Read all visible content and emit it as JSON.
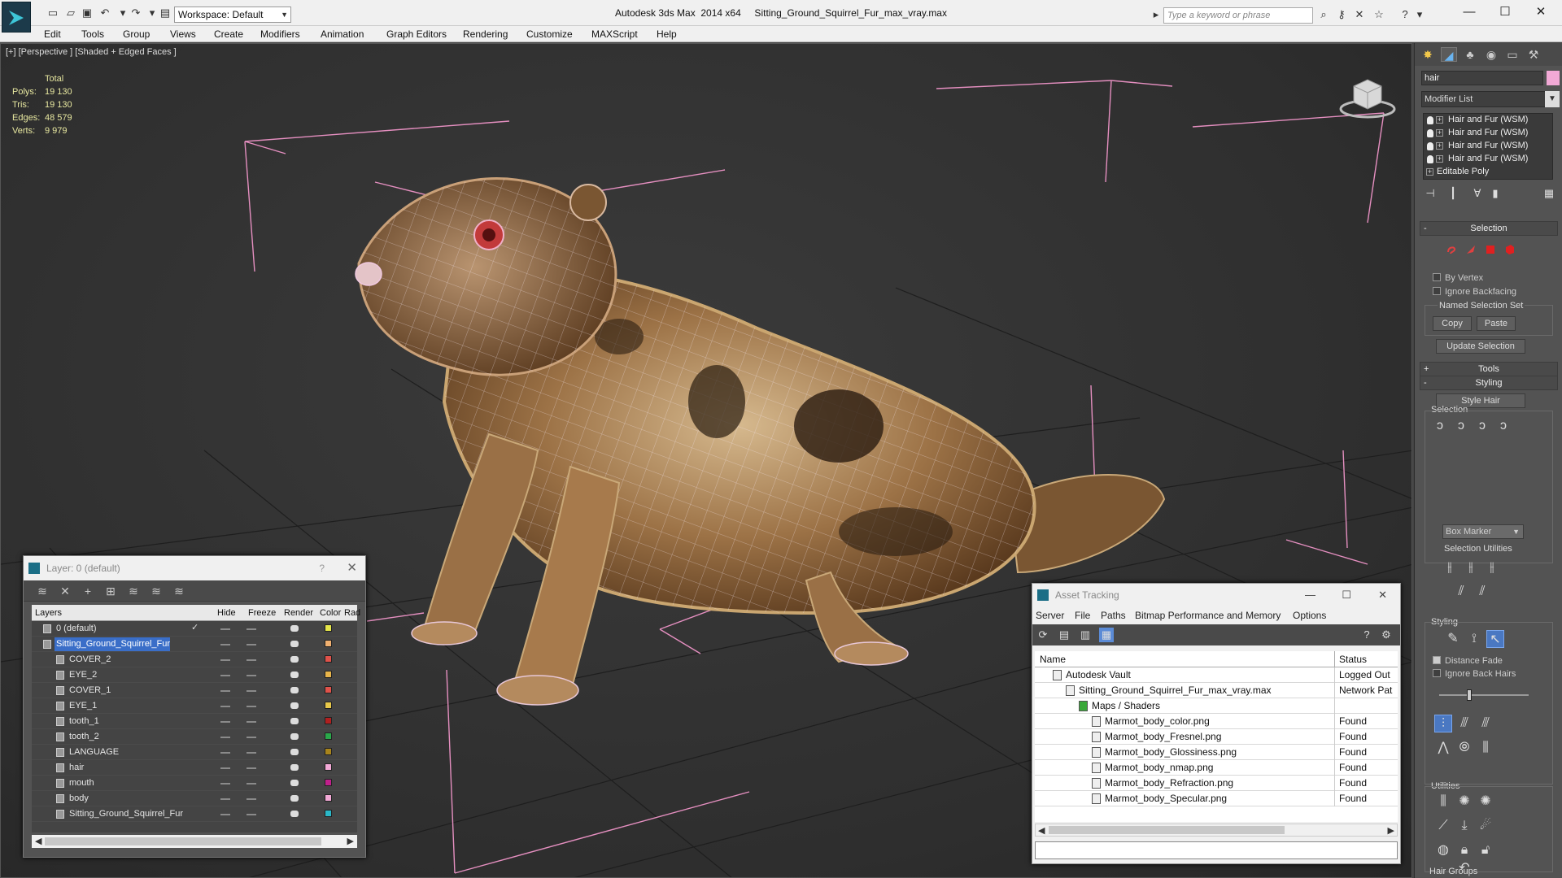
{
  "titlebar": {
    "workspace": "Workspace: Default",
    "title": "Autodesk 3ds Max  2014 x64     Sitting_Ground_Squirrel_Fur_max_vray.max",
    "search_placeholder": "Type a keyword or phrase",
    "icons": [
      "new-icon",
      "open-icon",
      "save-icon",
      "undo-icon",
      "redo-icon",
      "project-icon"
    ],
    "right_icons": [
      "binoculars-icon",
      "key-icon",
      "communication-icon",
      "star-icon",
      "help-icon"
    ]
  },
  "menu": [
    "Edit",
    "Tools",
    "Group",
    "Views",
    "Create",
    "Modifiers",
    "Animation",
    "Graph Editors",
    "Rendering",
    "Customize",
    "MAXScript",
    "Help"
  ],
  "viewport": {
    "label": "[+] [Perspective ] [Shaded + Edged Faces ]",
    "stats_header": "Total",
    "stats": [
      {
        "key": "Polys:",
        "value": "19 130"
      },
      {
        "key": "Tris:",
        "value": "19 130"
      },
      {
        "key": "Edges:",
        "value": "48 579"
      },
      {
        "key": "Verts:",
        "value": "9 979"
      }
    ]
  },
  "layer_window": {
    "title": "Layer: 0 (default)",
    "help": "?",
    "columns": [
      "Layers",
      "Hide",
      "Freeze",
      "Render",
      "Color",
      "Rad"
    ],
    "rows": [
      {
        "name": "0 (default)",
        "indent": 0,
        "color": "#e6e64a",
        "check": "✓",
        "selected": false
      },
      {
        "name": "Sitting_Ground_Squirrel_Fur",
        "indent": 0,
        "color": "#f0b070",
        "check": "",
        "selected": true
      },
      {
        "name": "COVER_2",
        "indent": 1,
        "color": "#e0524a",
        "check": "",
        "selected": false
      },
      {
        "name": "EYE_2",
        "indent": 1,
        "color": "#e8b44a",
        "check": "",
        "selected": false
      },
      {
        "name": "COVER_1",
        "indent": 1,
        "color": "#e0524a",
        "check": "",
        "selected": false
      },
      {
        "name": "EYE_1",
        "indent": 1,
        "color": "#e8c84a",
        "check": "",
        "selected": false
      },
      {
        "name": "tooth_1",
        "indent": 1,
        "color": "#b02020",
        "check": "",
        "selected": false
      },
      {
        "name": "tooth_2",
        "indent": 1,
        "color": "#2aa84a",
        "check": "",
        "selected": false
      },
      {
        "name": "LANGUAGE",
        "indent": 1,
        "color": "#a8841c",
        "check": "",
        "selected": false
      },
      {
        "name": "hair",
        "indent": 1,
        "color": "#f2a9d6",
        "check": "",
        "selected": false
      },
      {
        "name": "mouth",
        "indent": 1,
        "color": "#c0208c",
        "check": "",
        "selected": false
      },
      {
        "name": "body",
        "indent": 1,
        "color": "#f2a9d6",
        "check": "",
        "selected": false
      },
      {
        "name": "Sitting_Ground_Squirrel_Fur",
        "indent": 1,
        "color": "#2ab8c8",
        "check": "",
        "selected": false
      }
    ]
  },
  "asset_window": {
    "title": "Asset Tracking",
    "menu": [
      "Server",
      "File",
      "Paths",
      "Bitmap Performance and Memory",
      "Options"
    ],
    "columns": [
      "Name",
      "Status"
    ],
    "rows": [
      {
        "name": "Autodesk Vault",
        "indent": 0,
        "status": "Logged Out"
      },
      {
        "name": "Sitting_Ground_Squirrel_Fur_max_vray.max",
        "indent": 1,
        "status": "Network Pat"
      },
      {
        "name": "Maps / Shaders",
        "indent": 2,
        "status": ""
      },
      {
        "name": "Marmot_body_color.png",
        "indent": 3,
        "status": "Found"
      },
      {
        "name": "Marmot_body_Fresnel.png",
        "indent": 3,
        "status": "Found"
      },
      {
        "name": "Marmot_body_Glossiness.png",
        "indent": 3,
        "status": "Found"
      },
      {
        "name": "Marmot_body_nmap.png",
        "indent": 3,
        "status": "Found"
      },
      {
        "name": "Marmot_body_Refraction.png",
        "indent": 3,
        "status": "Found"
      },
      {
        "name": "Marmot_body_Specular.png",
        "indent": 3,
        "status": "Found"
      }
    ]
  },
  "command_panel": {
    "object_name": "hair",
    "object_color": "#f2a9d6",
    "modifier_list": "Modifier List",
    "stack": [
      "Hair and Fur (WSM)",
      "Hair and Fur (WSM)",
      "Hair and Fur (WSM)",
      "Hair and Fur (WSM)",
      "Editable Poly"
    ],
    "selection_rollout": "Selection",
    "by_vertex": "By Vertex",
    "ignore_backfacing": "Ignore Backfacing",
    "named_selection_set": "Named Selection Set",
    "copy": "Copy",
    "paste": "Paste",
    "update_selection": "Update Selection",
    "tools_rollout": "Tools",
    "styling_rollout": "Styling",
    "style_hair": "Style Hair",
    "selection_group": "Selection",
    "box_marker": "Box Marker",
    "selection_utilities": "Selection Utilities",
    "styling_group": "Styling",
    "distance_fade": "Distance Fade",
    "ignore_back_hairs": "Ignore Back Hairs",
    "utilities_group": "Utilities",
    "hair_groups": "Hair Groups",
    "rollout_minus": "-",
    "rollout_plus": "+"
  }
}
